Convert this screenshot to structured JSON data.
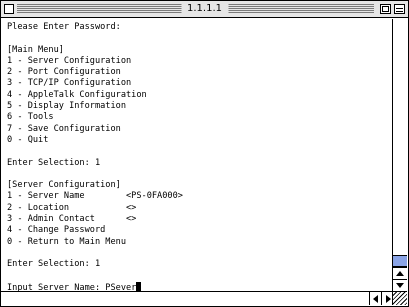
{
  "window": {
    "title": "1.1.1.1",
    "accent_color": "#8aa4e6"
  },
  "terminal": {
    "lines": [
      "Please Enter Password:",
      "",
      "[Main Menu]",
      "1 - Server Configuration",
      "2 - Port Configuration",
      "3 - TCP/IP Configuration",
      "4 - AppleTalk Configuration",
      "5 - Display Information",
      "6 - Tools",
      "7 - Save Configuration",
      "0 - Quit",
      "",
      "Enter Selection: 1",
      "",
      "[Server Configuration]",
      "1 - Server Name        <PS-0FA000>",
      "2 - Location           <>",
      "3 - Admin Contact      <>",
      "4 - Change Password",
      "0 - Return to Main Menu",
      "",
      "Enter Selection: 1",
      "",
      "Input Server Name: PSever"
    ]
  },
  "icons": {
    "close": "close-box-icon",
    "zoom": "zoom-box-icon",
    "collapse": "collapse-box-icon",
    "scroll_up": "arrow-up-icon",
    "scroll_down": "arrow-down-icon",
    "scroll_left": "arrow-left-icon",
    "scroll_right": "arrow-right-icon",
    "grow": "resize-grip-icon"
  }
}
